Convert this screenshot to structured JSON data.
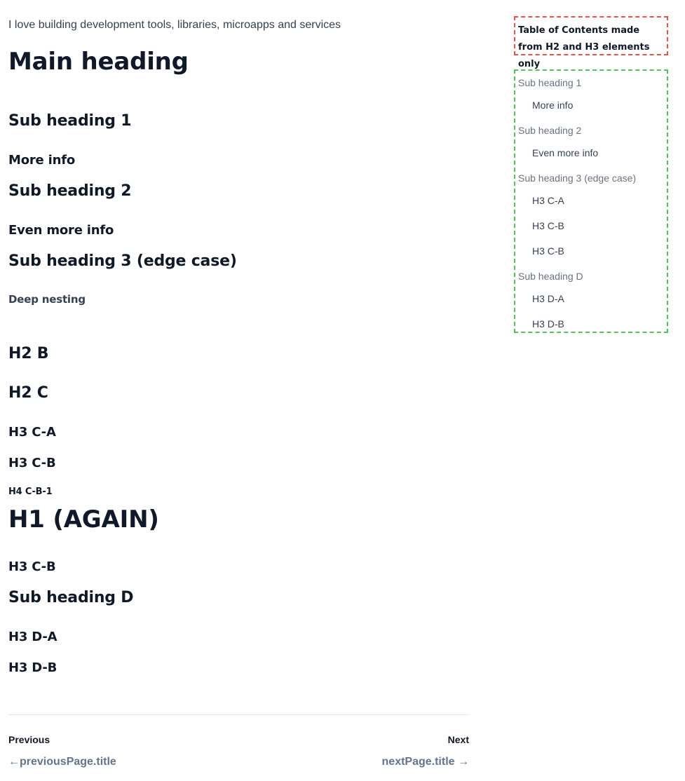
{
  "tagline": "I love building development tools, libraries, microapps and services",
  "content": {
    "headings": [
      {
        "level": 1,
        "text": "Main heading"
      },
      {
        "level": 2,
        "text": "Sub heading 1"
      },
      {
        "level": 3,
        "text": "More info"
      },
      {
        "level": 2,
        "text": "Sub heading 2"
      },
      {
        "level": 3,
        "text": "Even more info"
      },
      {
        "level": 2,
        "text": "Sub heading 3 (edge case)"
      },
      {
        "level": 4,
        "text": "Deep nesting"
      },
      {
        "level": 2,
        "text": "H2 B"
      },
      {
        "level": 2,
        "text": "H2 C"
      },
      {
        "level": 3,
        "text": "H3 C-A"
      },
      {
        "level": 3,
        "text": "H3 C-B"
      },
      {
        "level": 4,
        "text": "H4 C-B-1"
      },
      {
        "level": 1,
        "text": "H1 (AGAIN)"
      },
      {
        "level": 3,
        "text": "H3 C-B"
      },
      {
        "level": 2,
        "text": "Sub heading D"
      },
      {
        "level": 3,
        "text": "H3 D-A"
      },
      {
        "level": 3,
        "text": "H3 D-B"
      }
    ]
  },
  "pager": {
    "previous_label": "Previous",
    "previous_arrow": "←",
    "previous_title": "previousPage.title",
    "next_label": "Next",
    "next_title": "nextPage.title",
    "next_arrow": "→"
  },
  "toc": {
    "note": "Table of Contents made from H2 and H3 elements only",
    "note_border_color": "#e0564b",
    "list_border_color": "#55c05c",
    "items": [
      {
        "level": 2,
        "text": "Sub heading 1"
      },
      {
        "level": 3,
        "text": "More info"
      },
      {
        "level": 2,
        "text": "Sub heading 2"
      },
      {
        "level": 3,
        "text": "Even more info"
      },
      {
        "level": 2,
        "text": "Sub heading 3 (edge case)"
      },
      {
        "level": 3,
        "text": "H3 C-A"
      },
      {
        "level": 3,
        "text": "H3 C-B"
      },
      {
        "level": 3,
        "text": "H3 C-B"
      },
      {
        "level": 2,
        "text": "Sub heading D"
      },
      {
        "level": 3,
        "text": "H3 D-A"
      },
      {
        "level": 3,
        "text": "H3 D-B"
      }
    ]
  }
}
